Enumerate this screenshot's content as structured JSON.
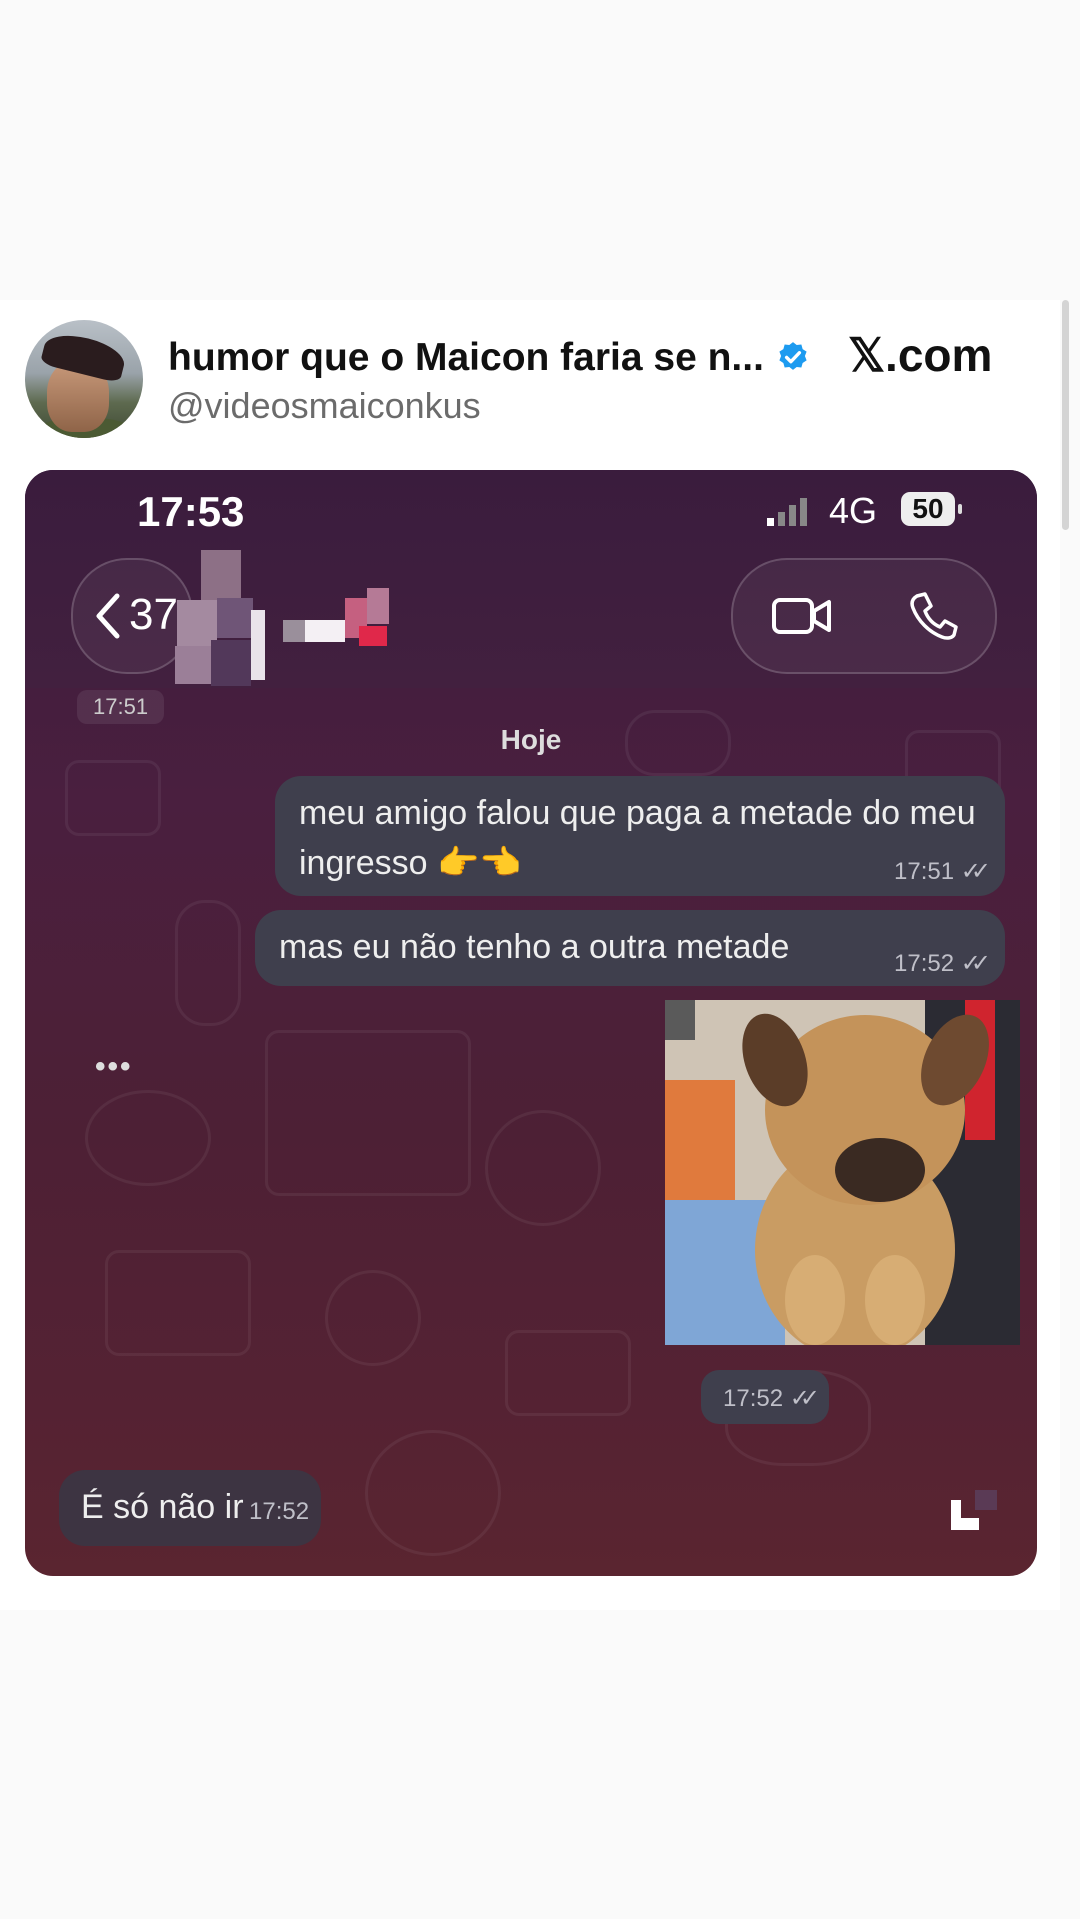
{
  "post": {
    "display_name": "humor que o Maicon faria se n...",
    "handle": "@videosmaiconkus",
    "site": "𝕏.com",
    "verified_color": "#1d9bf0"
  },
  "screenshot": {
    "status_bar": {
      "time": "17:53",
      "network": "4G",
      "battery": "50"
    },
    "header": {
      "back_count": "37",
      "icons": [
        "back-chevron-icon",
        "video-camera-icon",
        "phone-icon"
      ]
    },
    "chat": {
      "previous_timestamp": "17:51",
      "date_label": "Hoje",
      "messages": [
        {
          "text": "meu amigo falou que paga a metade do meu ingresso 👉👈",
          "time": "17:51",
          "direction": "outgoing",
          "status": "read"
        },
        {
          "text": "mas eu não tenho a outra metade",
          "time": "17:52",
          "direction": "outgoing",
          "status": "read"
        },
        {
          "type": "photo",
          "subject": "puppy",
          "time": "17:52",
          "direction": "outgoing",
          "status": "read"
        },
        {
          "text": "É só não ir",
          "time": "17:52",
          "direction": "incoming"
        }
      ],
      "typing_indicator": "•••"
    },
    "colors": {
      "bubble": "#3f3f4d",
      "background": "#4a1f3f"
    }
  }
}
